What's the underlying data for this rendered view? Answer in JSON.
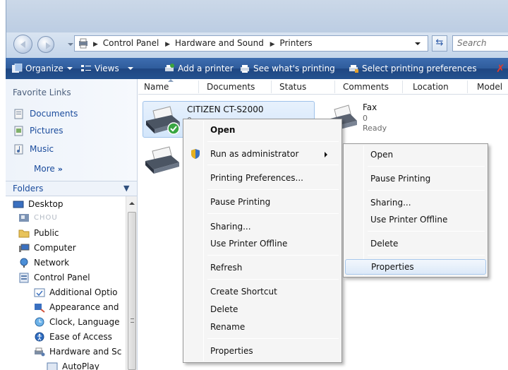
{
  "address": {
    "crumbs": [
      "Control Panel",
      "Hardware and Sound",
      "Printers"
    ],
    "search_placeholder": "Search"
  },
  "toolbar": {
    "organize": "Organize",
    "views": "Views",
    "add_printer": "Add a printer",
    "see_printing": "See what's printing",
    "select_prefs": "Select printing preferences"
  },
  "nav": {
    "favorite_links_title": "Favorite Links",
    "favorites": [
      "Documents",
      "Pictures",
      "Music"
    ],
    "more": "More",
    "folders_title": "Folders",
    "tree": [
      "Desktop",
      "CHOU",
      "Public",
      "Computer",
      "Network",
      "Control Panel",
      "Additional Optio",
      "Appearance and",
      "Clock, Language",
      "Ease of Access",
      "Hardware and Sc",
      "AutoPlay"
    ]
  },
  "columns": [
    "Name",
    "Documents",
    "Status",
    "Comments",
    "Location",
    "Model"
  ],
  "printers": {
    "citizen": {
      "name": "CITIZEN CT-S2000",
      "docs": "0"
    },
    "fax": {
      "name": "Fax",
      "docs": "0",
      "status": "Ready"
    }
  },
  "context_menu": {
    "items": [
      "Open",
      "Run as administrator",
      "Printing Preferences...",
      "Pause Printing",
      "Sharing...",
      "Use Printer Offline",
      "Refresh",
      "Create Shortcut",
      "Delete",
      "Rename",
      "Properties"
    ]
  },
  "submenu": {
    "items": [
      "Open",
      "Pause Printing",
      "Sharing...",
      "Use Printer Offline",
      "Delete",
      "Properties"
    ]
  },
  "colors": {
    "toolbar": "#2f5c9c",
    "link": "#1a4b9c",
    "highlight": "#dce9f8"
  }
}
